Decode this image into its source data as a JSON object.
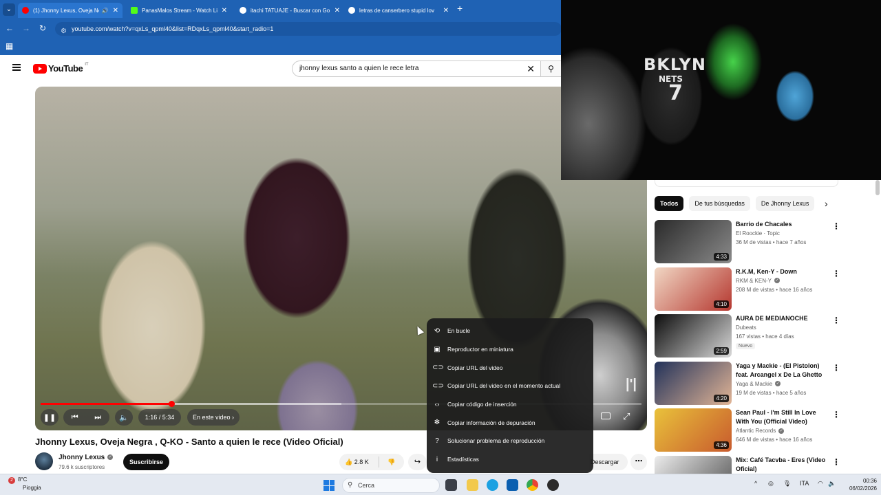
{
  "browser": {
    "tabs": [
      {
        "title": "(1) Jhonny Lexus, Oveja Ne",
        "active": true,
        "favicon_color": "#ff0000",
        "audio": true
      },
      {
        "title": "PanasMalos Stream - Watch Li",
        "active": false,
        "favicon_color": "#53fc18"
      },
      {
        "title": "itachi TATUAJE - Buscar con Go",
        "active": false,
        "favicon_color": "#ffffff"
      },
      {
        "title": "letras de canserbero stupid lov",
        "active": false,
        "favicon_color": "#ffffff"
      }
    ],
    "url": "youtube.com/watch?v=qxLs_qpml40&list=RDqxLs_qpml40&start_radio=1"
  },
  "youtube": {
    "logo_text": "YouTube",
    "country_code": "IT",
    "search_value": "jhonny lexus santo a quien le rece letra"
  },
  "player": {
    "progress_fraction": 0.218,
    "buffered_fraction": 0.5,
    "time": "1:16 / 5:34",
    "chapter_label": "En este video",
    "watermark": "|'|"
  },
  "context_menu": {
    "items": [
      {
        "icon": "loop-icon",
        "glyph": "⟲",
        "label": "En bucle"
      },
      {
        "icon": "miniplayer-icon",
        "glyph": "▣",
        "label": "Reproductor en miniatura"
      },
      {
        "icon": "link-icon",
        "glyph": "⊂⊃",
        "label": "Copiar URL del video"
      },
      {
        "icon": "link-time-icon",
        "glyph": "⊂⊃",
        "label": "Copiar URL del video en el momento actual"
      },
      {
        "icon": "embed-code-icon",
        "glyph": "‹›",
        "label": "Copiar código de inserción"
      },
      {
        "icon": "debug-icon",
        "glyph": "✻",
        "label": "Copiar información de depuración"
      },
      {
        "icon": "help-icon",
        "glyph": "?",
        "label": "Solucionar problema de reproducción"
      },
      {
        "icon": "info-icon",
        "glyph": "i",
        "label": "Estadísticas"
      }
    ]
  },
  "video_info": {
    "title": "Jhonny Lexus, Oveja Negra , Q-KO - Santo a quien le rece (Video Oficial)",
    "channel": "Jhonny Lexus",
    "subscribers": "79.6 k suscriptores",
    "subscribe_label": "Suscribirse",
    "likes": "2.8 K",
    "download_label": "Descargar"
  },
  "pip": {
    "jersey_line1": "BKLYN",
    "jersey_line2": "NETS",
    "jersey_number": "7"
  },
  "sidebar": {
    "chips": [
      {
        "label": "Todos",
        "active": true
      },
      {
        "label": "De tus búsquedas",
        "active": false
      },
      {
        "label": "De Jhonny Lexus",
        "active": false
      }
    ],
    "recommendations": [
      {
        "title": "Barrio de Chacales",
        "channel": "El Roockie · Topic",
        "verified": false,
        "meta": "36 M de vistas • hace 7 años",
        "duration": "4:33",
        "thumb_colors": [
          "#2a2a2a",
          "#8a8a8a"
        ]
      },
      {
        "title": "R.K.M, Ken-Y - Down",
        "channel": "RKM & KEN-Y",
        "verified": true,
        "meta": "208 M de vistas • hace 16 años",
        "duration": "4:10",
        "thumb_colors": [
          "#f1d7c4",
          "#b5372f"
        ]
      },
      {
        "title": "AURA DE MEDIANOCHE",
        "channel": "Dubeats",
        "verified": false,
        "meta": "167 vistas • hace 4 días",
        "duration": "2:59",
        "badge": "Nuevo",
        "thumb_colors": [
          "#0c0c0c",
          "#d9d9d9"
        ]
      },
      {
        "title": "Yaga y Mackie - (El Pistolon) feat. Arcangel x De La Ghetto ...",
        "channel": "Yaga & Mackie",
        "verified": true,
        "meta": "19 M de vistas • hace 5 años",
        "duration": "4:20",
        "thumb_colors": [
          "#22325a",
          "#e2b596"
        ]
      },
      {
        "title": "Sean Paul - I'm Still In Love With You (Official Video)",
        "channel": "Atlantic Records",
        "verified": true,
        "meta": "646 M de vistas • hace 16 años",
        "duration": "4:36",
        "thumb_colors": [
          "#e9c23b",
          "#c85a2d"
        ]
      },
      {
        "title": "Mix: Café Tacvba - Eres (Video Oficial)",
        "channel": "",
        "verified": false,
        "meta": "",
        "duration": "",
        "thumb_colors": [
          "#ececec",
          "#505050"
        ]
      }
    ]
  },
  "taskbar": {
    "weather_temp": "8°C",
    "weather_cond": "Pioggia",
    "weather_badge": "2",
    "search_placeholder": "Cerca",
    "language": "ITA",
    "time": "00:36",
    "date": "06/02/2026"
  }
}
